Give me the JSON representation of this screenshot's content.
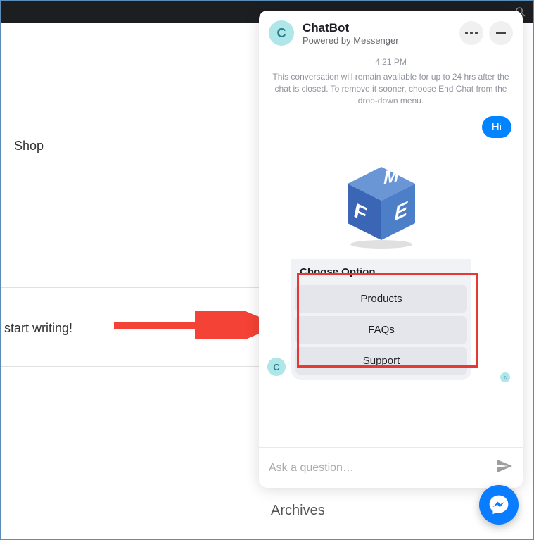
{
  "background": {
    "shop_label": "Shop",
    "start_writing": "start writing!",
    "archives": "Archives"
  },
  "chat": {
    "header": {
      "avatar_letter": "C",
      "name": "ChatBot",
      "powered": "Powered by Messenger"
    },
    "timestamp": "4:21 PM",
    "notice": "This conversation will remain available for up to 24 hrs after the chat is closed. To remove it sooner, choose End Chat from the drop-down menu.",
    "user_message": "Hi",
    "card": {
      "title": "Choose Option",
      "options": [
        "Products",
        "FAQs",
        "Support"
      ],
      "logo_letters": {
        "f": "F",
        "m": "M",
        "e": "E"
      }
    },
    "input_placeholder": "Ask a question…",
    "small_avatar": "C",
    "xs_avatar": "c"
  }
}
